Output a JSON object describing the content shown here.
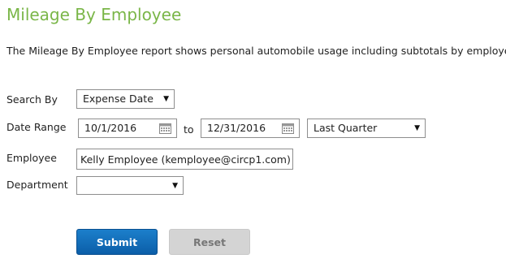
{
  "page": {
    "title": "Mileage By Employee",
    "description": "The Mileage By Employee report shows personal automobile usage including subtotals by employee."
  },
  "form": {
    "search_by": {
      "label": "Search By",
      "value": "Expense Date"
    },
    "date_range": {
      "label": "Date Range",
      "from": "10/1/2016",
      "to_label": "to",
      "to": "12/31/2016",
      "preset": "Last Quarter"
    },
    "employee": {
      "label": "Employee",
      "value": "Kelly Employee (kemployee@circp1.com)"
    },
    "department": {
      "label": "Department",
      "value": ""
    }
  },
  "buttons": {
    "submit": "Submit",
    "reset": "Reset"
  },
  "icons": {
    "dropdown": "chevron-down-icon",
    "calendar": "calendar-icon"
  },
  "colors": {
    "title": "#7ab648",
    "submit": "#0b5ea8",
    "reset": "#d4d4d4"
  }
}
